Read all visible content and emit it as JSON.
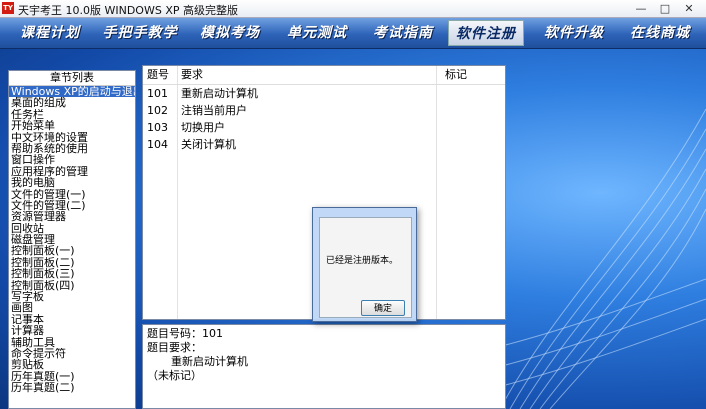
{
  "window": {
    "title": "天宇考王 10.0版 WINDOWS XP 高级完整版",
    "icon_text": "TY",
    "min": "—",
    "max": "□",
    "close": "✕"
  },
  "menu": {
    "items": [
      {
        "label": "课程计划"
      },
      {
        "label": "手把手教学"
      },
      {
        "label": "模拟考场"
      },
      {
        "label": "单元测试"
      },
      {
        "label": "考试指南"
      },
      {
        "label": "软件注册"
      },
      {
        "label": "软件升级"
      },
      {
        "label": "在线商城"
      }
    ],
    "active_index": 5
  },
  "chapters": {
    "header": "章节列表",
    "items": [
      "Windows XP的启动与退出",
      "桌面的组成",
      "任务栏",
      "开始菜单",
      "中文环境的设置",
      "帮助系统的使用",
      "窗口操作",
      "应用程序的管理",
      "我的电脑",
      "文件的管理(一)",
      "文件的管理(二)",
      "资源管理器",
      "回收站",
      "磁盘管理",
      "控制面板(一)",
      "控制面板(二)",
      "控制面板(三)",
      "控制面板(四)",
      "写字板",
      "画图",
      "记事本",
      "计算器",
      "辅助工具",
      "命令提示符",
      "剪贴板",
      "历年真题(一)",
      "历年真题(二)"
    ],
    "selected_index": 0
  },
  "questions": {
    "headers": {
      "num": "题号",
      "req": "要求",
      "mark": "标记"
    },
    "rows": [
      {
        "num": "101",
        "req": "重新启动计算机"
      },
      {
        "num": "102",
        "req": "注销当前用户"
      },
      {
        "num": "103",
        "req": "切换用户"
      },
      {
        "num": "104",
        "req": "关闭计算机"
      }
    ]
  },
  "detail": {
    "line1": "题目号码：101",
    "line2": "题目要求：",
    "line3": "重新启动计算机",
    "line4": "（未标记）"
  },
  "dialog": {
    "message": "已经是注册版本。",
    "ok": "确定"
  }
}
